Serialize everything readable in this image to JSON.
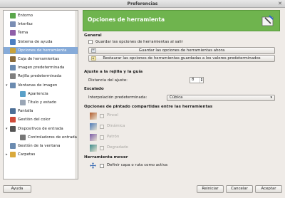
{
  "window": {
    "title": "Preferencias"
  },
  "sidebar": {
    "items": [
      {
        "label": "Entorno",
        "icon": "environment-icon",
        "color": "#5aa64b",
        "level": 0
      },
      {
        "label": "Interfaz",
        "icon": "interface-icon",
        "color": "#7a8db3",
        "level": 0
      },
      {
        "label": "Tema",
        "icon": "theme-icon",
        "color": "#8f5ea8",
        "level": 0
      },
      {
        "label": "Sistema de ayuda",
        "icon": "help-icon",
        "color": "#4c7fc1",
        "level": 0
      },
      {
        "label": "Opciones de herramienta",
        "icon": "tool-options-icon",
        "color": "#c9a33a",
        "level": 0,
        "selected": true
      },
      {
        "label": "Caja de herramientas",
        "icon": "toolbox-icon",
        "color": "#8a6b3a",
        "level": 0
      },
      {
        "label": "Imagen predeterminada",
        "icon": "default-image-icon",
        "color": "#6b8bb0",
        "level": 0
      },
      {
        "label": "Rejilla predeterminada",
        "icon": "grid-icon",
        "color": "#7f7f7f",
        "level": 0
      },
      {
        "label": "Ventanas de imagen",
        "icon": "image-windows-icon",
        "color": "#6b8bb0",
        "level": 0,
        "expander": "▾"
      },
      {
        "label": "Apariencia",
        "icon": "appearance-icon",
        "color": "#5aa0c8",
        "level": 1
      },
      {
        "label": "Título y estado",
        "icon": "title-status-icon",
        "color": "#9aa6b5",
        "level": 1
      },
      {
        "label": "Pantalla",
        "icon": "display-icon",
        "color": "#4d6f96",
        "level": 0
      },
      {
        "label": "Gestión del color",
        "icon": "color-management-icon",
        "color": "#d04b3a",
        "level": 0
      },
      {
        "label": "Dispositivos de entrada",
        "icon": "input-devices-icon",
        "color": "#555555",
        "level": 0,
        "expander": "▾"
      },
      {
        "label": "Controladores de entrada",
        "icon": "input-controllers-icon",
        "color": "#777777",
        "level": 1
      },
      {
        "label": "Gestión de la ventana",
        "icon": "window-management-icon",
        "color": "#6b8bb0",
        "level": 0
      },
      {
        "label": "Carpetas",
        "icon": "folders-icon",
        "color": "#d9a93c",
        "level": 0,
        "expander": "▸"
      }
    ]
  },
  "banner": {
    "title": "Opciones de herramienta",
    "color": "#6fb44e"
  },
  "general": {
    "heading": "General",
    "save_on_exit": "Guardar las opciones de herramientas al salir",
    "save_now_button": "Guardar las opciones de herramientas ahora",
    "restore_button": "Restaurar las opciones de herramientas guardadas a los valores predeterminados"
  },
  "grid": {
    "heading": "Ajuste a la rejilla y la guía",
    "distance_label": "Distancia del ajuste:",
    "distance_value": "8"
  },
  "scaling": {
    "heading": "Escalado",
    "interp_label": "Interpolación predeterminada:",
    "interp_value": "Cúbica"
  },
  "paint": {
    "heading": "Opciones de pintado compartidas entre las herramientas",
    "items": [
      {
        "label": "Pincel",
        "icon": "paintbrush-icon"
      },
      {
        "label": "Dinámica",
        "icon": "dynamics-icon"
      },
      {
        "label": "Patrón",
        "icon": "pattern-icon"
      },
      {
        "label": "Degradado",
        "icon": "gradient-icon"
      }
    ]
  },
  "move": {
    "heading": "Herramienta mover",
    "active_layer": "Definir capa o ruta como activa"
  },
  "footer": {
    "help": "Ayuda",
    "reset": "Reiniciar",
    "cancel": "Cancelar",
    "accept": "Aceptar"
  }
}
